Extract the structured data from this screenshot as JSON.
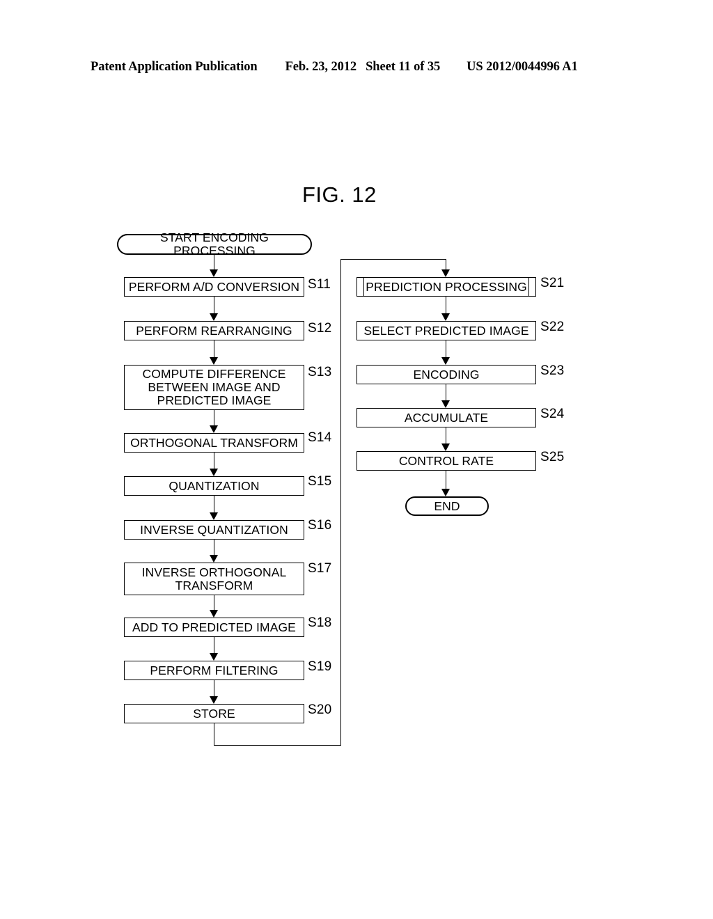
{
  "header": {
    "publication": "Patent Application Publication",
    "date": "Feb. 23, 2012",
    "sheet": "Sheet 11 of 35",
    "number": "US 2012/0044996 A1"
  },
  "figure": {
    "title": "FIG. 12"
  },
  "flowchart": {
    "start": {
      "label": "START ENCODING PROCESSING",
      "shape": "terminal"
    },
    "end": {
      "label": "END",
      "shape": "terminal"
    },
    "left_column": [
      {
        "step": "S11",
        "label": "PERFORM A/D CONVERSION",
        "shape": "process"
      },
      {
        "step": "S12",
        "label": "PERFORM REARRANGING",
        "shape": "process"
      },
      {
        "step": "S13",
        "label": "COMPUTE DIFFERENCE\nBETWEEN IMAGE AND\nPREDICTED IMAGE",
        "shape": "process"
      },
      {
        "step": "S14",
        "label": "ORTHOGONAL TRANSFORM",
        "shape": "process"
      },
      {
        "step": "S15",
        "label": "QUANTIZATION",
        "shape": "process"
      },
      {
        "step": "S16",
        "label": "INVERSE QUANTIZATION",
        "shape": "process"
      },
      {
        "step": "S17",
        "label": "INVERSE ORTHOGONAL\nTRANSFORM",
        "shape": "process"
      },
      {
        "step": "S18",
        "label": "ADD TO PREDICTED IMAGE",
        "shape": "process"
      },
      {
        "step": "S19",
        "label": "PERFORM FILTERING",
        "shape": "process"
      },
      {
        "step": "S20",
        "label": "STORE",
        "shape": "process"
      }
    ],
    "right_column": [
      {
        "step": "S21",
        "label": "PREDICTION PROCESSING",
        "shape": "predefined-process"
      },
      {
        "step": "S22",
        "label": "SELECT PREDICTED IMAGE",
        "shape": "process"
      },
      {
        "step": "S23",
        "label": "ENCODING",
        "shape": "process"
      },
      {
        "step": "S24",
        "label": "ACCUMULATE",
        "shape": "process"
      },
      {
        "step": "S25",
        "label": "CONTROL RATE",
        "shape": "process"
      }
    ]
  }
}
